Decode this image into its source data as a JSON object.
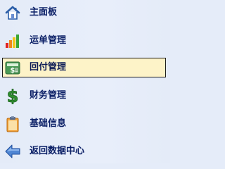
{
  "menu": {
    "items": [
      {
        "label": "主面板",
        "icon": "home-icon"
      },
      {
        "label": "运单管理",
        "icon": "bar-chart-icon"
      },
      {
        "label": "回付管理",
        "icon": "calculator-icon",
        "selected": true
      },
      {
        "label": "财务管理",
        "icon": "dollar-icon"
      },
      {
        "label": "基础信息",
        "icon": "clipboard-icon"
      },
      {
        "label": "返回数据中心",
        "icon": "back-arrow-icon"
      }
    ]
  },
  "colors": {
    "background": "#e5ecf9",
    "label_text": "#0b1f66",
    "selected_fill": "#fdf3c8",
    "selected_border": "#1a1a1a"
  }
}
